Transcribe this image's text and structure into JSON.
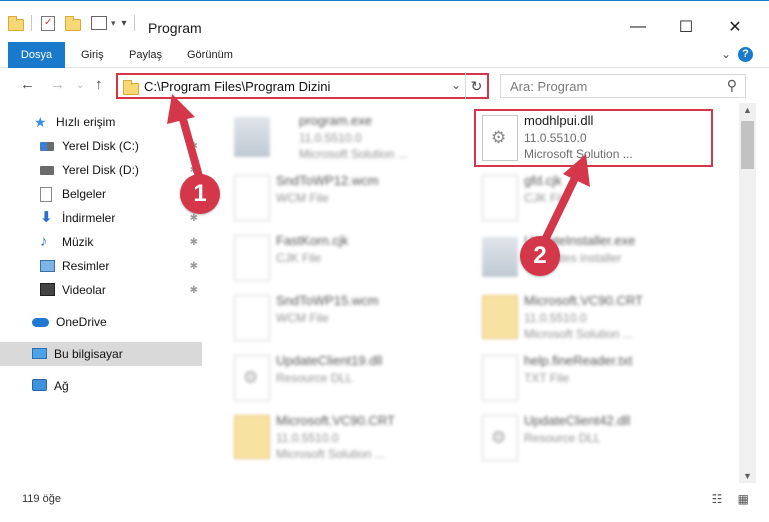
{
  "window": {
    "title": "Program",
    "minimize": "—",
    "maximize": "☐",
    "close": "✕"
  },
  "ribbon": {
    "tabs": [
      "Dosya",
      "Giriş",
      "Paylaş",
      "Görünüm"
    ],
    "expand": "⌄",
    "help": "?"
  },
  "address": {
    "path": "C:\\Program Files\\Program Dizini",
    "dropdown": "⌄",
    "refresh": "↻",
    "search_placeholder": "Ara: Program"
  },
  "nav": {
    "items": [
      {
        "label": "Hızlı erişim",
        "icon": "star-icon"
      },
      {
        "label": "Yerel Disk (C:)",
        "icon": "windows-disk-icon",
        "pinned": true
      },
      {
        "label": "Yerel Disk (D:)",
        "icon": "disk-icon",
        "pinned": true
      },
      {
        "label": "Belgeler",
        "icon": "documents-icon",
        "pinned": true
      },
      {
        "label": "İndirmeler",
        "icon": "download-icon",
        "pinned": true
      },
      {
        "label": "Müzik",
        "icon": "music-icon",
        "pinned": true
      },
      {
        "label": "Resimler",
        "icon": "pictures-icon",
        "pinned": true
      },
      {
        "label": "Videolar",
        "icon": "videos-icon",
        "pinned": true
      },
      {
        "label": "OneDrive",
        "icon": "onedrive-icon"
      },
      {
        "label": "Bu bilgisayar",
        "icon": "computer-icon",
        "selected": true
      },
      {
        "label": "Ağ",
        "icon": "network-icon"
      }
    ]
  },
  "files": [
    {
      "name": "program.exe",
      "line1": "11.0.5510.0",
      "line2": "Microsoft Solution ...",
      "icon": "exe-icon",
      "blurred": true
    },
    {
      "name": "modhlpui.dll",
      "line1": "11.0.5510.0",
      "line2": "Microsoft Solution ...",
      "icon": "dll-icon",
      "blurred": false
    },
    {
      "name": "SndToWP12.wcm",
      "line1": "WCM File",
      "line2": "",
      "icon": "file-icon",
      "blurred": true
    },
    {
      "name": "gfd.cjk",
      "line1": "CJK File",
      "line2": "",
      "icon": "file-icon",
      "blurred": true
    },
    {
      "name": "FastKorn.cjk",
      "line1": "CJK File",
      "line2": "",
      "icon": "file-icon",
      "blurred": true
    },
    {
      "name": "UpdateInstaller.exe",
      "line1": "...updates installer",
      "line2": "",
      "icon": "exe-icon",
      "blurred": true
    },
    {
      "name": "SndToWP15.wcm",
      "line1": "WCM File",
      "line2": "",
      "icon": "file-icon",
      "blurred": true
    },
    {
      "name": "Microsoft.VC90.CRT",
      "line1": "11.0.5510.0",
      "line2": "Microsoft Solution ...",
      "icon": "folder-icon",
      "blurred": true
    },
    {
      "name": "UpdateClient19.dll",
      "line1": "Resource DLL",
      "line2": "",
      "icon": "dll-icon",
      "blurred": true
    },
    {
      "name": "help.fineReader.txt",
      "line1": "TXT File",
      "line2": "",
      "icon": "file-icon",
      "blurred": true
    },
    {
      "name": "Microsoft.VC90.CRT",
      "line1": "11.0.5510.0",
      "line2": "Microsoft Solution ...",
      "icon": "folder-icon",
      "blurred": true
    },
    {
      "name": "UpdateClient42.dll",
      "line1": "Resource DLL",
      "line2": "",
      "icon": "dll-icon",
      "blurred": true
    }
  ],
  "status": {
    "count": "119 öğe",
    "views": "☷ ▦"
  },
  "annotations": {
    "step1": "1",
    "step2": "2",
    "color": "#d4364a"
  }
}
